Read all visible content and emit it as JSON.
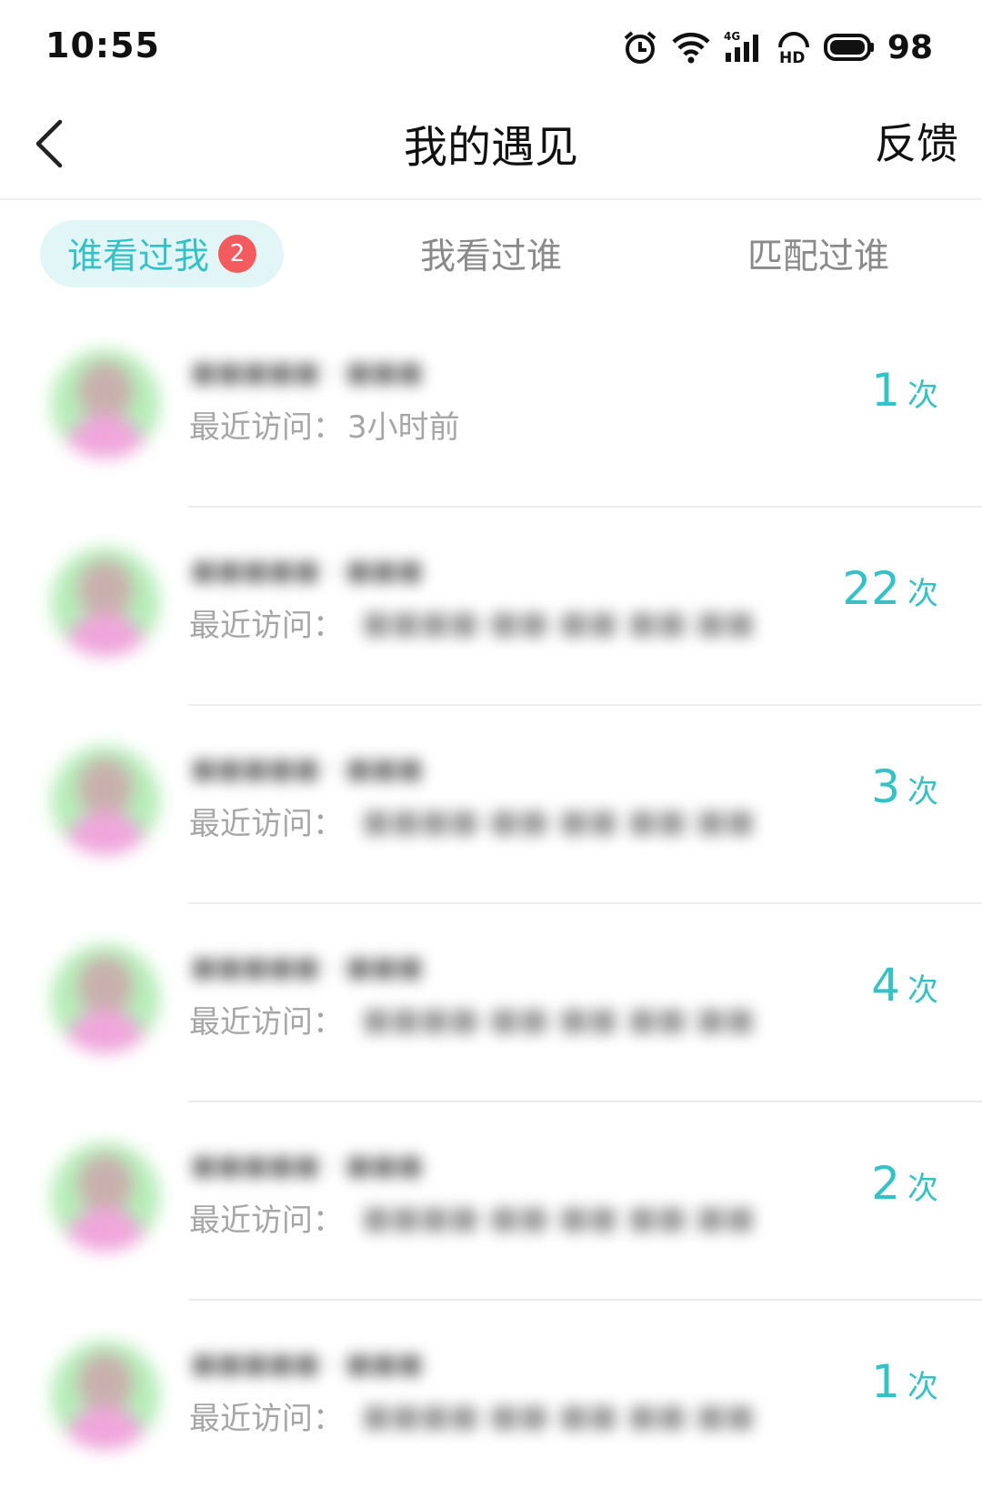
{
  "status_bar": {
    "time": "10:55",
    "battery": "98"
  },
  "header": {
    "title": "我的遇见",
    "feedback": "反馈"
  },
  "tabs": [
    {
      "label": "谁看过我",
      "badge": "2",
      "active": true
    },
    {
      "label": "我看过谁",
      "active": false
    },
    {
      "label": "匹配过谁",
      "active": false
    }
  ],
  "colors": {
    "accent": "#35c2c7",
    "badge": "#f45b5f",
    "tab_active_bg": "#e3f6f7",
    "muted_text": "#a6a6a6"
  },
  "list": {
    "visit_label": "最近访问：",
    "count_unit": "次",
    "items": [
      {
        "name": "■■■■■ · ■■■",
        "last_visit": "3小时前",
        "count": "1"
      },
      {
        "name": "■■■■■ · ■■■",
        "last_visit": "■■■■-■■-■■ ■■:■■",
        "count": "22"
      },
      {
        "name": "■■■■■ · ■■■",
        "last_visit": "■■■■-■■-■■ ■■:■■",
        "count": "3"
      },
      {
        "name": "■■■■■ · ■■■",
        "last_visit": "■■■■-■■-■■ ■■:■■",
        "count": "4"
      },
      {
        "name": "■■■■■ · ■■■",
        "last_visit": "■■■■-■■-■■ ■■:■■",
        "count": "2"
      },
      {
        "name": "■■■■■ · ■■■",
        "last_visit": "■■■■-■■-■■ ■■:■■",
        "count": "1"
      }
    ]
  }
}
